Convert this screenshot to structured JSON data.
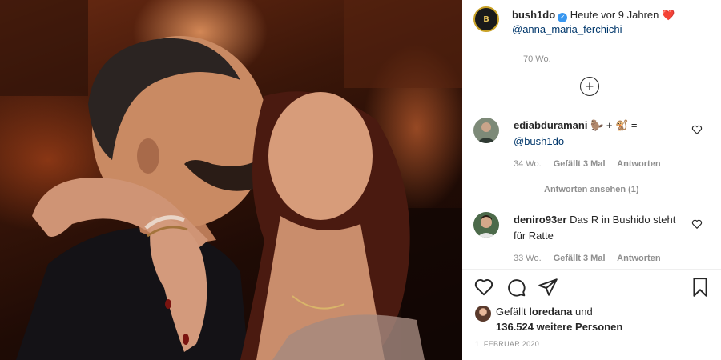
{
  "post": {
    "author": "bush1do",
    "author_avatar_text": "B",
    "caption_text": "Heute vor 9 Jahren",
    "caption_emoji": "❤️",
    "caption_mention": "@anna_maria_ferchichi",
    "caption_time": "70 Wo."
  },
  "comments": [
    {
      "username": "ediabduramani",
      "text": "🦫 + 🐒 =",
      "mention": "@bush1do",
      "time": "34 Wo.",
      "likes": "Gefällt 3 Mal",
      "reply": "Antworten"
    },
    {
      "username": "deniro93er",
      "text": "Das R in Bushido steht für Ratte",
      "time": "33 Wo.",
      "likes": "Gefällt 3 Mal",
      "reply": "Antworten"
    }
  ],
  "view_replies": "Antworten ansehen (1)",
  "likes": {
    "prefix": "Gefällt",
    "liker": "loredana",
    "connector": "und",
    "count_text": "136.524 weitere Personen"
  },
  "date": "1. FEBRUAR 2020",
  "icons": {
    "load_more": "plus-circle-icon",
    "like": "heart-outline-icon",
    "comment": "speech-bubble-icon",
    "share": "paper-plane-icon",
    "save": "bookmark-icon"
  },
  "colors": {
    "link": "#00376b",
    "verified": "#3897f0",
    "muted": "#8e8e8e",
    "heart": "#ed4956"
  }
}
